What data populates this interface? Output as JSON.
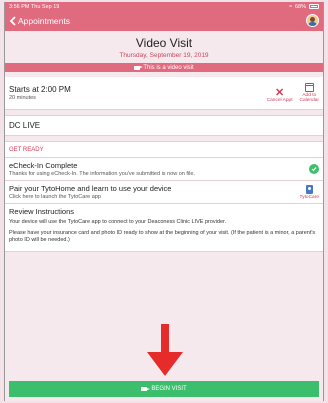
{
  "status_bar": {
    "time": "3:56 PM  Thu Sep 19",
    "battery": "68%"
  },
  "nav": {
    "back_label": "Appointments"
  },
  "header": {
    "title": "Video Visit",
    "date": "Thursday, September 19, 2019"
  },
  "video_banner": {
    "label": "This is a video visit"
  },
  "appointment": {
    "starts": "Starts at 2:00 PM",
    "duration": "20 minutes",
    "cancel_label": "Cancel Appt",
    "calendar_label_1": "Add to",
    "calendar_label_2": "Calendar"
  },
  "provider": {
    "name": "DC LIVE"
  },
  "get_ready": {
    "label": "GET READY",
    "echeck": {
      "title": "eCheck-In Complete",
      "subtitle": "Thanks for using eCheck-In. The information you've submitted is now on file."
    },
    "pair": {
      "title": "Pair your TytoHome and learn to use your device",
      "subtitle": "Click here to launch the TytoCare app",
      "icon_label": "TytoCare"
    },
    "review": {
      "title": "Review Instructions",
      "p1": "Your device will use the TytoCare app to connect to your Deaconess Clinic LIVE provider.",
      "p2": "Please have your insurance card and photo ID ready to show at the beginning of your visit.  (If the patient is a minor, a parent's photo ID will be needed.)"
    }
  },
  "begin_visit": {
    "label": "BEGIN VISIT"
  },
  "colors": {
    "accent": "#e06a7e",
    "danger": "#d63a55",
    "success": "#3cbf6c",
    "arrow": "#e62b2b"
  }
}
